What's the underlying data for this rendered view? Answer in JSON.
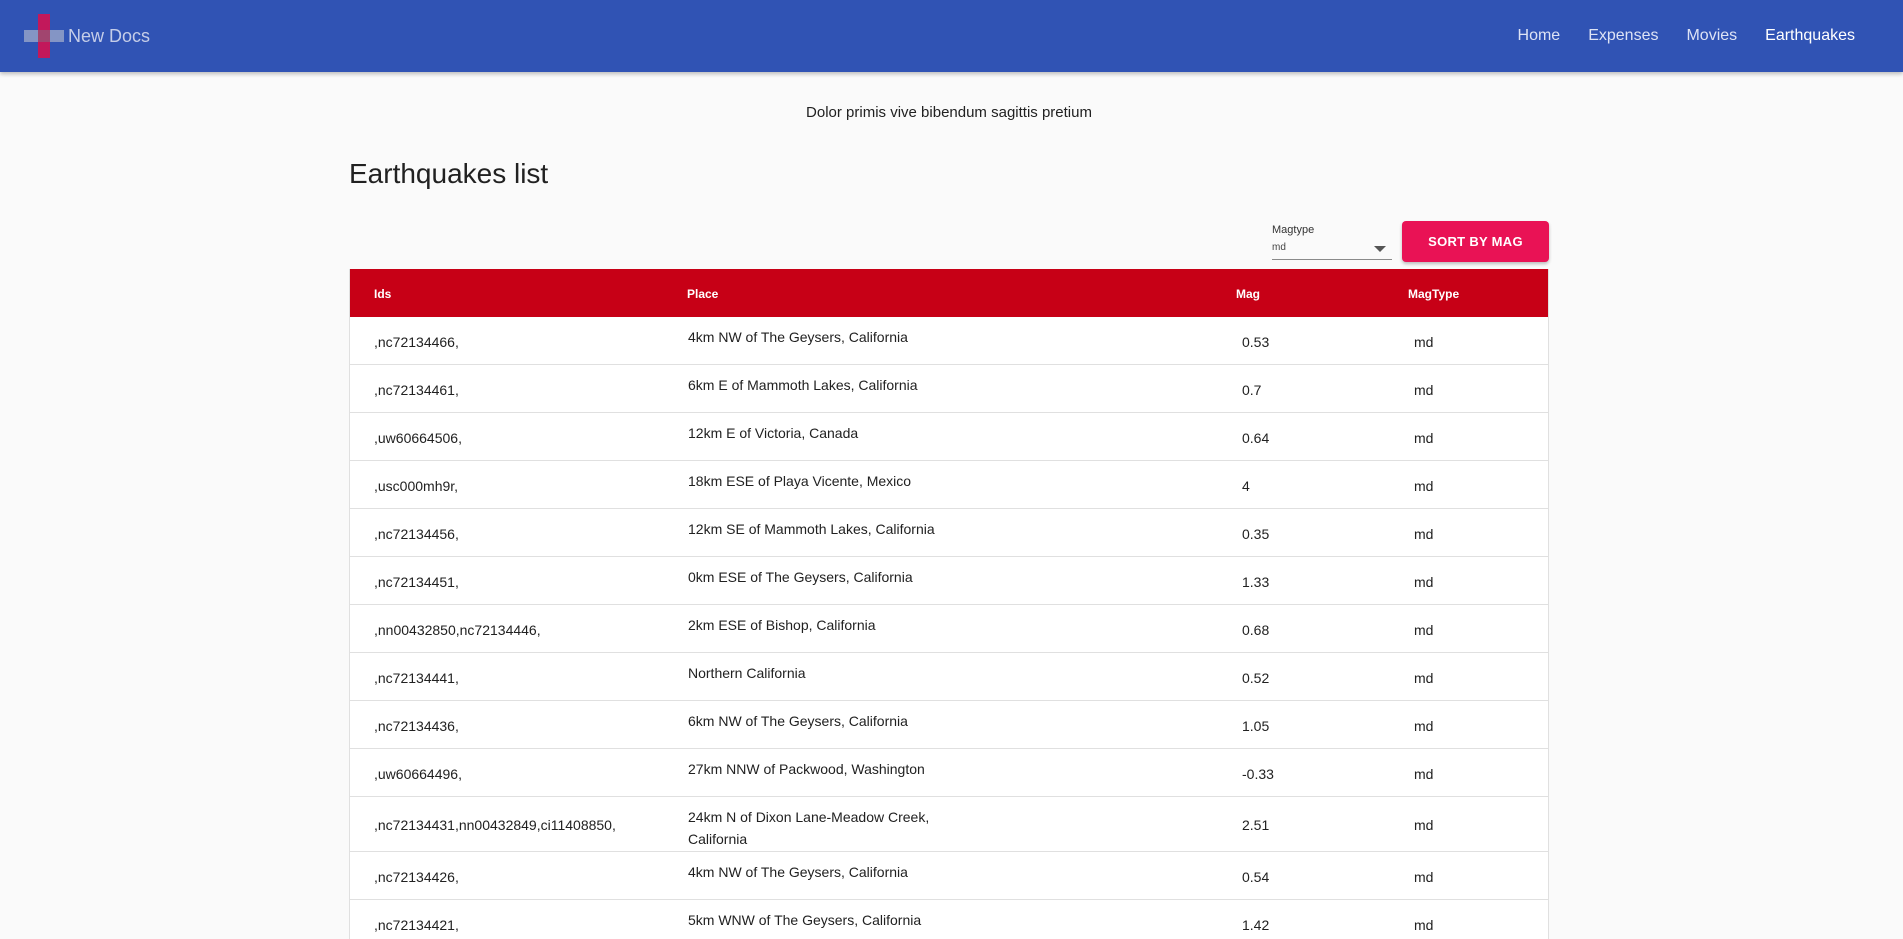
{
  "app": {
    "name": "New Docs"
  },
  "nav": [
    "Home",
    "Expenses",
    "Movies",
    "Earthquakes"
  ],
  "subtitle": "Dolor primis vive bibendum sagittis pretium",
  "page_title": "Earthquakes list",
  "filter": {
    "label": "Magtype",
    "value": "md"
  },
  "sort_button": "SORT BY MAG",
  "table": {
    "headers": [
      "Ids",
      "Place",
      "Mag",
      "MagType"
    ],
    "rows": [
      {
        "ids": ",nc72134466,",
        "place": "4km NW of The Geysers, California",
        "mag": "0.53",
        "magtype": "md"
      },
      {
        "ids": ",nc72134461,",
        "place": "6km E of Mammoth Lakes, California",
        "mag": "0.7",
        "magtype": "md"
      },
      {
        "ids": ",uw60664506,",
        "place": "12km E of Victoria, Canada",
        "mag": "0.64",
        "magtype": "md"
      },
      {
        "ids": ",usc000mh9r,",
        "place": "18km ESE of Playa Vicente, Mexico",
        "mag": "4",
        "magtype": "md"
      },
      {
        "ids": ",nc72134456,",
        "place": "12km SE of Mammoth Lakes, California",
        "mag": "0.35",
        "magtype": "md"
      },
      {
        "ids": ",nc72134451,",
        "place": "0km ESE of The Geysers, California",
        "mag": "1.33",
        "magtype": "md"
      },
      {
        "ids": ",nn00432850,nc72134446,",
        "place": "2km ESE of Bishop, California",
        "mag": "0.68",
        "magtype": "md"
      },
      {
        "ids": ",nc72134441,",
        "place": "Northern California",
        "mag": "0.52",
        "magtype": "md"
      },
      {
        "ids": ",nc72134436,",
        "place": "6km NW of The Geysers, California",
        "mag": "1.05",
        "magtype": "md"
      },
      {
        "ids": ",uw60664496,",
        "place": "27km NNW of Packwood, Washington",
        "mag": "-0.33",
        "magtype": "md"
      },
      {
        "ids": ",nc72134431,nn00432849,ci11408850,",
        "place": "24km N of Dixon Lane-Meadow Creek, California",
        "mag": "2.51",
        "magtype": "md"
      },
      {
        "ids": ",nc72134426,",
        "place": "4km NW of The Geysers, California",
        "mag": "0.54",
        "magtype": "md"
      },
      {
        "ids": ",nc72134421,",
        "place": "5km WNW of The Geysers, California",
        "mag": "1.42",
        "magtype": "md"
      }
    ]
  },
  "colors": {
    "appbar": "#3053b4",
    "table_header": "#c70016",
    "sort_button": "#e91255",
    "logo_accent": "#c2185b"
  },
  "icons": {
    "logo": "plus-logo-icon",
    "select_caret": "caret-down-icon"
  }
}
